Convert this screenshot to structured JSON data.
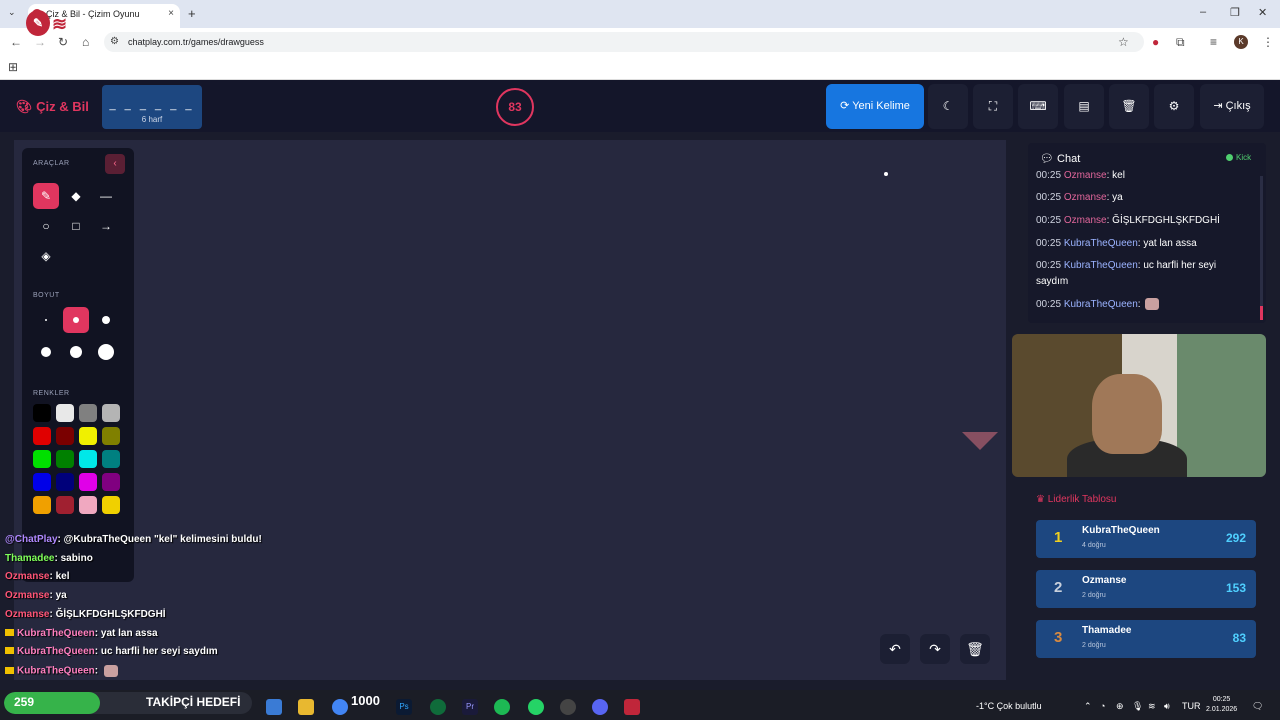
{
  "browser": {
    "tab_title": "Çiz & Bil - Çizim Oyunu",
    "tab_close": "×",
    "new_tab": "+",
    "url": "chatplay.com.tr/games/drawguess",
    "profile_initial": "K"
  },
  "header": {
    "brand": "Çiz & Bil",
    "word_dashes": "_ _ _ _ _ _",
    "word_length": "6 harf",
    "timer": "83",
    "new_word_label": "Yeni Kelime",
    "exit_label": "Çıkış"
  },
  "tools": {
    "section_tools": "ARAÇLAR",
    "section_size": "BOYUT",
    "section_colors": "RENKLER",
    "colors": [
      "#000000",
      "#e8e8e8",
      "#808080",
      "#b4b4b4",
      "#e00000",
      "#7a0000",
      "#f0f000",
      "#808000",
      "#00e000",
      "#008000",
      "#00e8e8",
      "#008080",
      "#0000e8",
      "#00007a",
      "#e000e8",
      "#800080",
      "#f0a000",
      "#a02030",
      "#f0a8c0",
      "#f0d000"
    ]
  },
  "overlay_chat": {
    "lines": [
      {
        "user": "@ChatPlay",
        "text": ": @KubraTheQueen \"kel\" kelimesini buldu!"
      },
      {
        "user": "Thamadee",
        "text": ": sabino"
      },
      {
        "user": "Ozmanse",
        "text": ": kel"
      },
      {
        "user": "Ozmanse",
        "text": ": ya"
      },
      {
        "user": "Ozmanse",
        "text": ": ĞİŞLKFDGHLŞKFDGHİ"
      },
      {
        "user": "KubraTheQueen",
        "text": ": yat lan assa"
      },
      {
        "user": "KubraTheQueen",
        "text": ": uc harfli her seyi saydım"
      },
      {
        "user": "KubraTheQueen",
        "text": ":"
      }
    ]
  },
  "chat": {
    "title": "Chat",
    "platform": "Kick",
    "messages": [
      {
        "time": "00:25",
        "user": "Ozmanse",
        "text": ": kel"
      },
      {
        "time": "00:25",
        "user": "Ozmanse",
        "text": ": ya"
      },
      {
        "time": "00:25",
        "user": "Ozmanse",
        "text": ": ĞİŞLKFDGHLŞKFDGHİ"
      },
      {
        "time": "00:25",
        "user": "KubraTheQueen",
        "text": ": yat lan assa"
      },
      {
        "time": "00:25",
        "user": "KubraTheQueen",
        "text": ": uc harfli her seyi saydım"
      },
      {
        "time": "00:25",
        "user": "KubraTheQueen",
        "text": ":"
      }
    ]
  },
  "leaderboard": {
    "title": "Liderlik Tablosu",
    "rows": [
      {
        "rank": "1",
        "name": "KubraTheQueen",
        "sub": "4 doğru",
        "score": "292",
        "rank_color": "#f0d020"
      },
      {
        "rank": "2",
        "name": "Ozmanse",
        "sub": "2 doğru",
        "score": "153",
        "rank_color": "#c8d0dc"
      },
      {
        "rank": "3",
        "name": "Thamadee",
        "sub": "2 doğru",
        "score": "83",
        "rank_color": "#d88a40"
      }
    ]
  },
  "taskbar": {
    "goal_current": "259",
    "goal_label": "TAKİPÇİ HEDEFİ",
    "goal_target": "1000",
    "goal_progress": 0.259,
    "weather": "-1°C  Çok bulutlu",
    "lang": "TUR",
    "time": "00:25",
    "date": "2.01.2026"
  }
}
